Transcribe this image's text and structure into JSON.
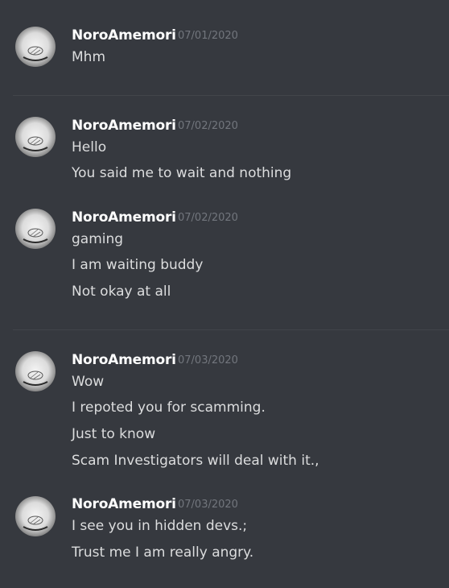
{
  "groups": [
    {
      "author": "NoroAmemori",
      "timestamp": "07/01/2020",
      "messages": [
        "Mhm"
      ]
    },
    {
      "author": "NoroAmemori",
      "timestamp": "07/02/2020",
      "messages": [
        "Hello",
        "You said me to wait and nothing"
      ]
    },
    {
      "author": "NoroAmemori",
      "timestamp": "07/02/2020",
      "messages": [
        "gaming",
        "I am waiting buddy",
        "Not okay at all"
      ]
    },
    {
      "author": "NoroAmemori",
      "timestamp": "07/03/2020",
      "messages": [
        "Wow",
        "I repoted you for scamming.",
        "Just to know",
        "Scam Investigators will deal with it.,"
      ]
    },
    {
      "author": "NoroAmemori",
      "timestamp": "07/03/2020",
      "messages": [
        "I see you in hidden devs.;",
        "Trust me I am really angry."
      ]
    }
  ],
  "colors": {
    "background": "#36393f",
    "author": "#ffffff",
    "message": "#dcddde",
    "timestamp": "#72767d",
    "divider": "#42454a"
  }
}
